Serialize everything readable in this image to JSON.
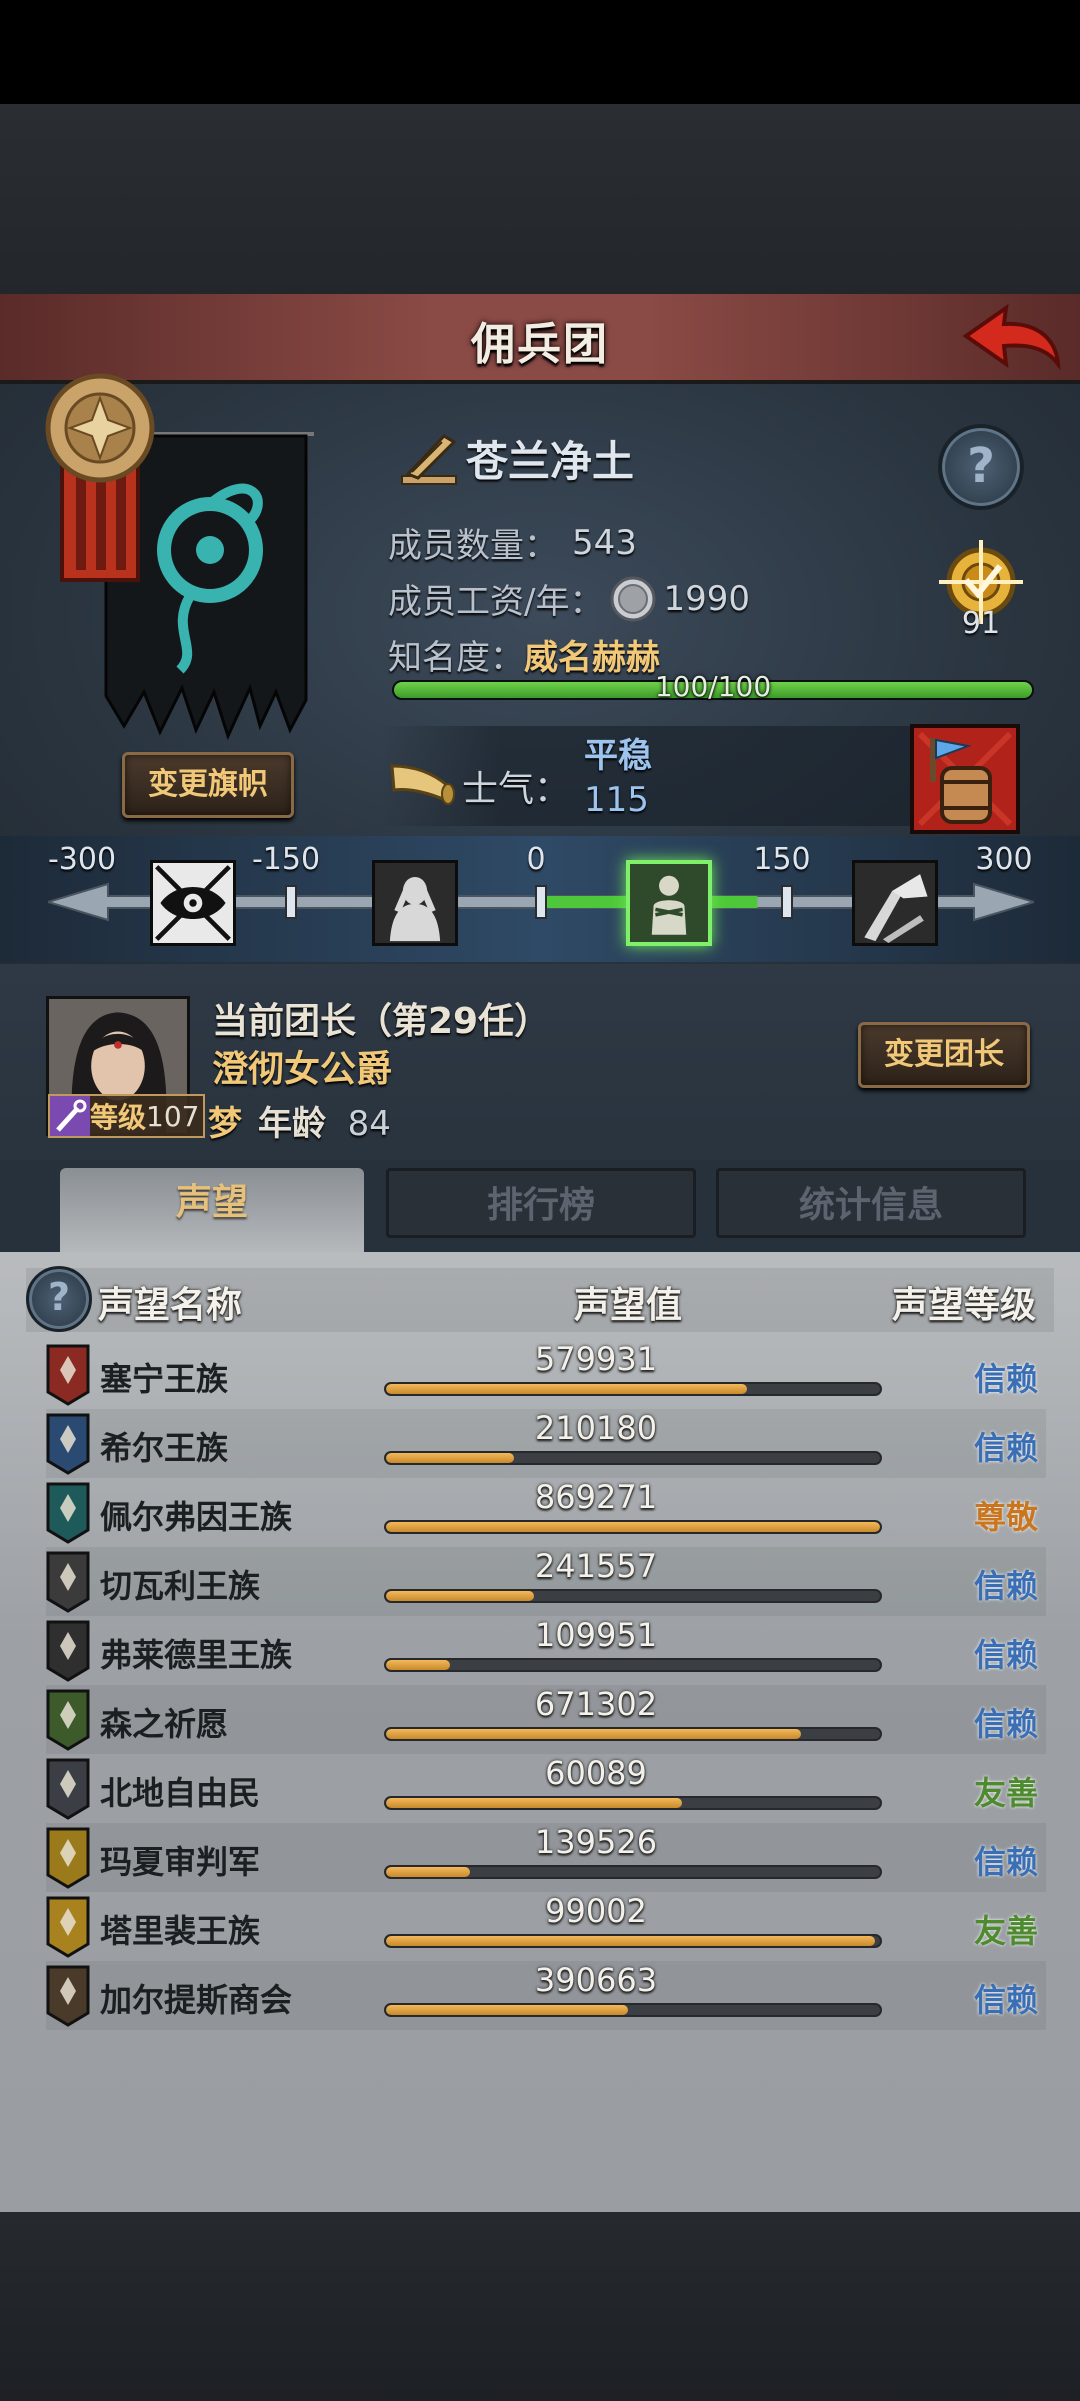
{
  "title": "佣兵团",
  "guild": {
    "name": "苍兰净土",
    "members_label": "成员数量：",
    "members": "543",
    "wage_label": "成员工资/年：",
    "wage": "1990",
    "fame_label": "知名度：",
    "fame_value": "威名赫赫",
    "fame_progress_text": "100/100",
    "fame_progress": 1.0,
    "target_value": "91",
    "change_flag_label": "变更旗帜"
  },
  "morale": {
    "label": "士气：",
    "state": "平稳",
    "value": "115",
    "ticks": [
      "-300",
      "-150",
      "0",
      "150",
      "300"
    ],
    "active_range_fraction": [
      0.5,
      0.75
    ]
  },
  "leader": {
    "title": "当前团长（第29任）",
    "name": "澄彻女公爵",
    "level_label": "等级",
    "level": "107",
    "trait": "梦",
    "age_label": "年龄",
    "age": "84",
    "change_label": "变更团长"
  },
  "tabs": [
    {
      "label": "声望",
      "active": true
    },
    {
      "label": "排行榜",
      "active": false
    },
    {
      "label": "统计信息",
      "active": false
    }
  ],
  "reputation": {
    "headers": {
      "name": "声望名称",
      "value": "声望值",
      "level": "声望等级"
    },
    "rows": [
      {
        "name": "塞宁王族",
        "value": "579931",
        "fill": 0.73,
        "level": "信赖",
        "level_color": "#3a6fb6",
        "icon_color": "#8a2a22"
      },
      {
        "name": "希尔王族",
        "value": "210180",
        "fill": 0.26,
        "level": "信赖",
        "level_color": "#3a6fb6",
        "icon_color": "#2a4a72"
      },
      {
        "name": "佩尔弗因王族",
        "value": "869271",
        "fill": 1.0,
        "level": "尊敬",
        "level_color": "#c9761e",
        "icon_color": "#1f5a5a"
      },
      {
        "name": "切瓦利王族",
        "value": "241557",
        "fill": 0.3,
        "level": "信赖",
        "level_color": "#3a6fb6",
        "icon_color": "#3b3b3b"
      },
      {
        "name": "弗莱德里王族",
        "value": "109951",
        "fill": 0.13,
        "level": "信赖",
        "level_color": "#3a6fb6",
        "icon_color": "#2f2f2f"
      },
      {
        "name": "森之祈愿",
        "value": "671302",
        "fill": 0.84,
        "level": "信赖",
        "level_color": "#3a6fb6",
        "icon_color": "#3d5a2a"
      },
      {
        "name": "北地自由民",
        "value": "60089",
        "fill": 0.6,
        "level": "友善",
        "level_color": "#4e8a2e",
        "icon_color": "#3b3f45"
      },
      {
        "name": "玛夏审判军",
        "value": "139526",
        "fill": 0.17,
        "level": "信赖",
        "level_color": "#3a6fb6",
        "icon_color": "#9a7a1a"
      },
      {
        "name": "塔里裴王族",
        "value": "99002",
        "fill": 0.99,
        "level": "友善",
        "level_color": "#4e8a2e",
        "icon_color": "#a8821e"
      },
      {
        "name": "加尔提斯商会",
        "value": "390663",
        "fill": 0.49,
        "level": "信赖",
        "level_color": "#3a6fb6",
        "icon_color": "#4a3a2a"
      }
    ]
  }
}
